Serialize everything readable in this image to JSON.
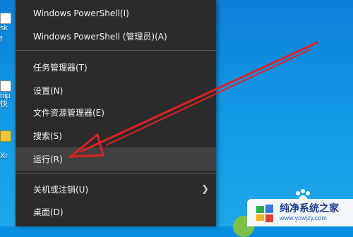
{
  "desktop_icons": [
    {
      "name": "app-icon-1",
      "label": "sk"
    },
    {
      "name": "app-icon-2",
      "label": "f"
    },
    {
      "name": "app-icon-3",
      "label": "nip"
    },
    {
      "name": "app-icon-4",
      "label": "快"
    },
    {
      "name": "app-icon-5",
      "label": "Xr"
    }
  ],
  "context_menu": {
    "items": [
      {
        "label": "Windows PowerShell(I)"
      },
      {
        "label": "Windows PowerShell (管理员)(A)"
      },
      {
        "label": "任务管理器(T)"
      },
      {
        "label": "设置(N)"
      },
      {
        "label": "文件资源管理器(E)"
      },
      {
        "label": "搜索(S)"
      },
      {
        "label": "运行(R)"
      },
      {
        "label": "关机或注销(U)"
      },
      {
        "label": "桌面(D)"
      }
    ]
  },
  "watermark": {
    "title": "纯净系统之家",
    "url": "www.ycwjzy.com"
  },
  "colors": {
    "menu_bg": "#2b2b2b",
    "highlight": "#414141",
    "arrow": "#e02020",
    "desktop": "#0b8de0"
  },
  "icons": {
    "submenu": "chevron-right-icon"
  }
}
